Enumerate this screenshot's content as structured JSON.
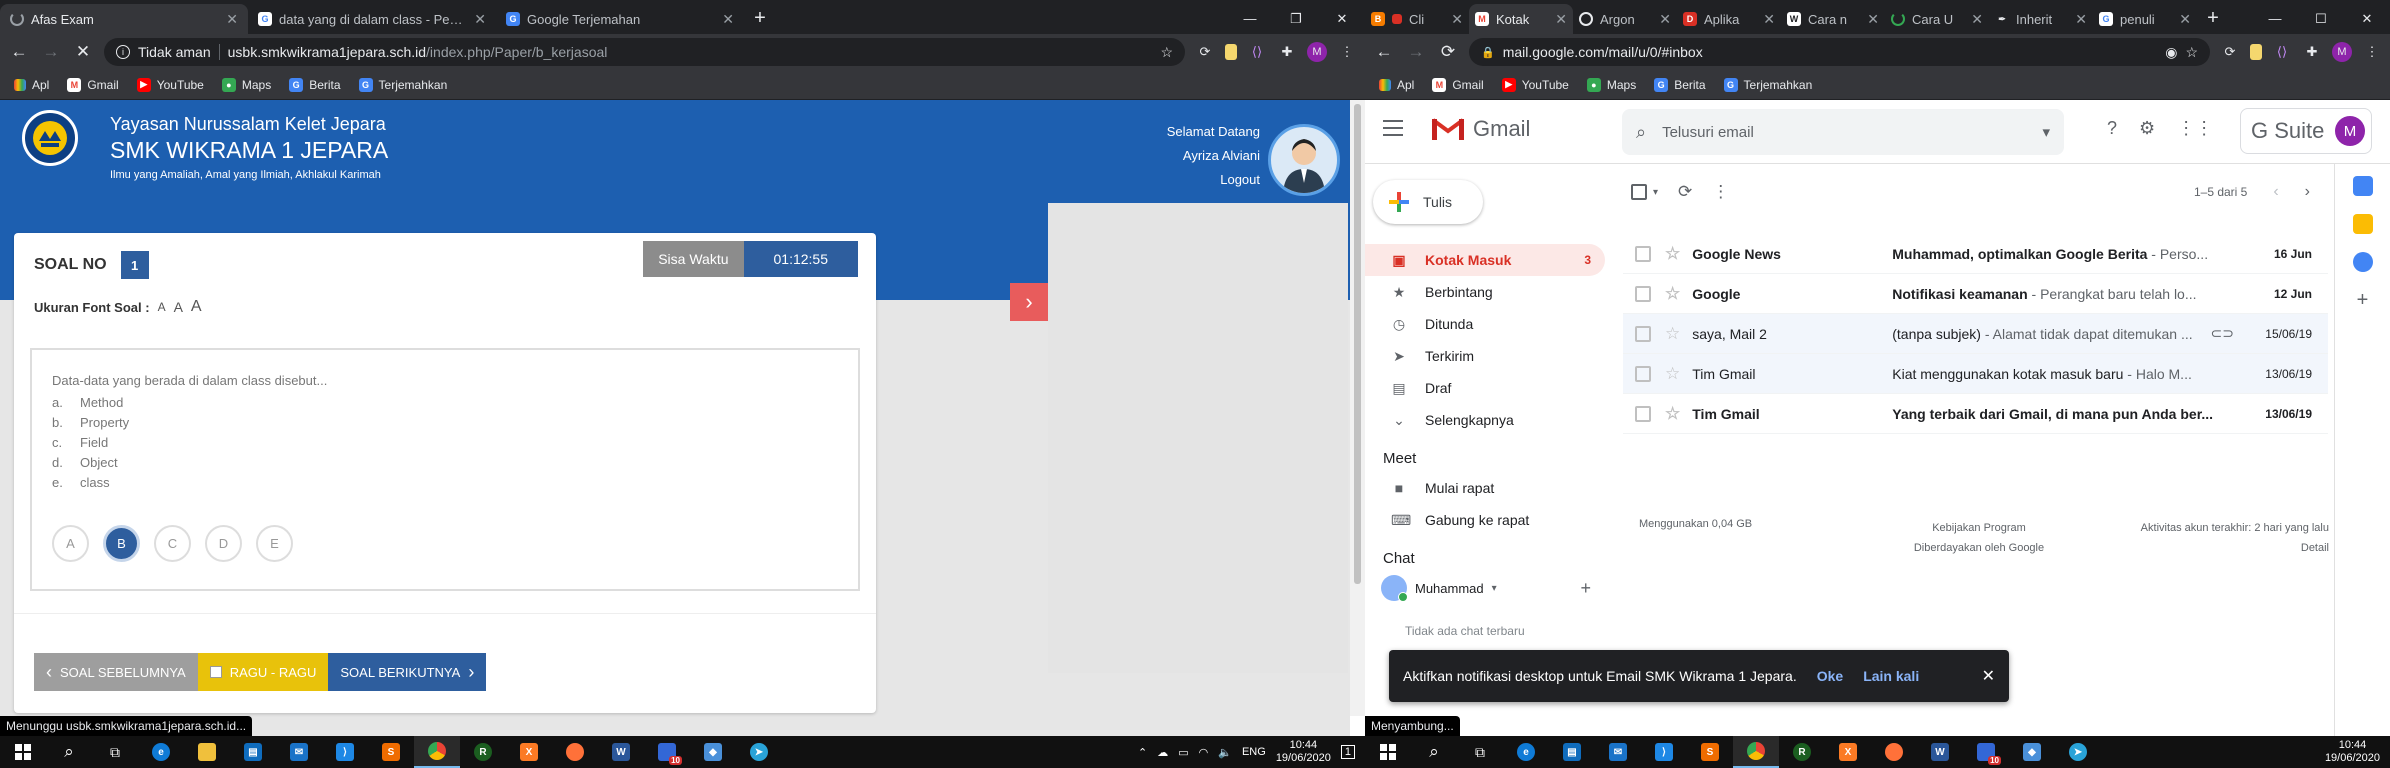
{
  "left": {
    "tabs": [
      {
        "title": "Afas Exam",
        "icon": "loading-icon",
        "active": true
      },
      {
        "title": "data yang di dalam class - Penelu",
        "icon": "google-icon"
      },
      {
        "title": "Google Terjemahan",
        "icon": "translate-icon"
      }
    ],
    "url": {
      "warning": "Tidak aman",
      "host": "usbk.smkwikrama1jepara.sch.id",
      "path": "/index.php/Paper/b_kerjasoal"
    },
    "bookmarks": [
      "Apl",
      "Gmail",
      "YouTube",
      "Maps",
      "Berita",
      "Terjemahkan"
    ],
    "header": {
      "org": "Yayasan Nurussalam Kelet Jepara",
      "school": "SMK WIKRAMA 1 JEPARA",
      "motto": "Ilmu yang Amaliah, Amal yang Ilmiah, Akhlakul Karimah",
      "greeting": "Selamat Datang",
      "user": "Ayriza Alviani",
      "logout": "Logout"
    },
    "exam": {
      "soal_label": "SOAL NO",
      "soal_number": "1",
      "timer_label": "Sisa Waktu",
      "timer_value": "01:12:55",
      "font_label": "Ukuran Font Soal :",
      "font_sizes": [
        "A",
        "A",
        "A"
      ],
      "question": "Data-data yang berada di dalam class disebut...",
      "options": [
        {
          "key": "a.",
          "text": "Method"
        },
        {
          "key": "b.",
          "text": "Property"
        },
        {
          "key": "c.",
          "text": "Field"
        },
        {
          "key": "d.",
          "text": "Object"
        },
        {
          "key": "e.",
          "text": "class"
        }
      ],
      "answers": [
        "A",
        "B",
        "C",
        "D",
        "E"
      ],
      "selected": "B",
      "prev_label": "SOAL SEBELUMNYA",
      "ragu_label": "RAGU - RAGU",
      "next_label": "SOAL BERIKUTNYA"
    },
    "status_text": "Menunggu usbk.smkwikrama1jepara.sch.id..."
  },
  "right": {
    "tabs": [
      "Cli",
      "Kotak",
      "Argon",
      "Aplika",
      "Cara n",
      "Cara U",
      "Inherit",
      "penuli"
    ],
    "url": "mail.google.com/mail/u/0/#inbox",
    "bookmarks": [
      "Apl",
      "Gmail",
      "YouTube",
      "Maps",
      "Berita",
      "Terjemahkan"
    ],
    "gmail": {
      "logo_text": "Gmail",
      "search_placeholder": "Telusuri email",
      "gsuite": "G Suite",
      "account_initial": "M",
      "compose": "Tulis",
      "nav": [
        {
          "label": "Kotak Masuk",
          "count": "3",
          "icon": "inbox-icon"
        },
        {
          "label": "Berbintang",
          "icon": "star-icon"
        },
        {
          "label": "Ditunda",
          "icon": "clock-icon"
        },
        {
          "label": "Terkirim",
          "icon": "send-icon"
        },
        {
          "label": "Draf",
          "icon": "draft-icon"
        },
        {
          "label": "Selengkapnya",
          "icon": "chevron-down-icon"
        }
      ],
      "meet_title": "Meet",
      "meet_items": [
        "Mulai rapat",
        "Gabung ke rapat"
      ],
      "chat_title": "Chat",
      "chat_user": "Muhammad",
      "chat_empty": "Tidak ada chat terbaru",
      "pager": "1–5 dari 5",
      "emails": [
        {
          "from": "Google News",
          "subject": "Muhammad, optimalkan Google Berita",
          "snippet": " - Perso...",
          "date": "16 Jun",
          "unread": true
        },
        {
          "from": "Google",
          "subject": "Notifikasi keamanan",
          "snippet": " - Perangkat baru telah lo...",
          "date": "12 Jun",
          "unread": true
        },
        {
          "from": "saya, Mail 2",
          "subject": "(tanpa subjek)",
          "snippet": " - Alamat tidak dapat ditemukan ...",
          "date": "15/06/19",
          "unread": false
        },
        {
          "from": "Tim Gmail",
          "subject": "Kiat menggunakan kotak masuk baru",
          "snippet": " - Halo M...",
          "date": "13/06/19",
          "unread": false
        },
        {
          "from": "Tim Gmail",
          "subject": "Yang terbaik dari Gmail, di mana pun Anda ber...",
          "snippet": "",
          "date": "13/06/19",
          "unread": true
        }
      ],
      "footer_usage": "Menggunakan 0,04 GB",
      "footer_policy_1": "Kebijakan Program",
      "footer_policy_2": "Diberdayakan oleh Google",
      "footer_activity_1": "Aktivitas akun terakhir: 2 hari yang lalu",
      "footer_activity_2": "Detail",
      "snackbar": "Aktifkan notifikasi desktop untuk Email SMK Wikrama 1 Jepara.",
      "snack_ok": "Oke",
      "snack_later": "Lain kali"
    },
    "status_text": "Menyambung..."
  },
  "taskbar": {
    "lang": "ENG",
    "time": "10:44",
    "date": "19/06/2020",
    "badge": "10",
    "notif_count": "1"
  },
  "colors": {
    "exam_header": "#1d5fb0",
    "exam_accent": "#2e5e9e",
    "gmail_red": "#d93025"
  }
}
